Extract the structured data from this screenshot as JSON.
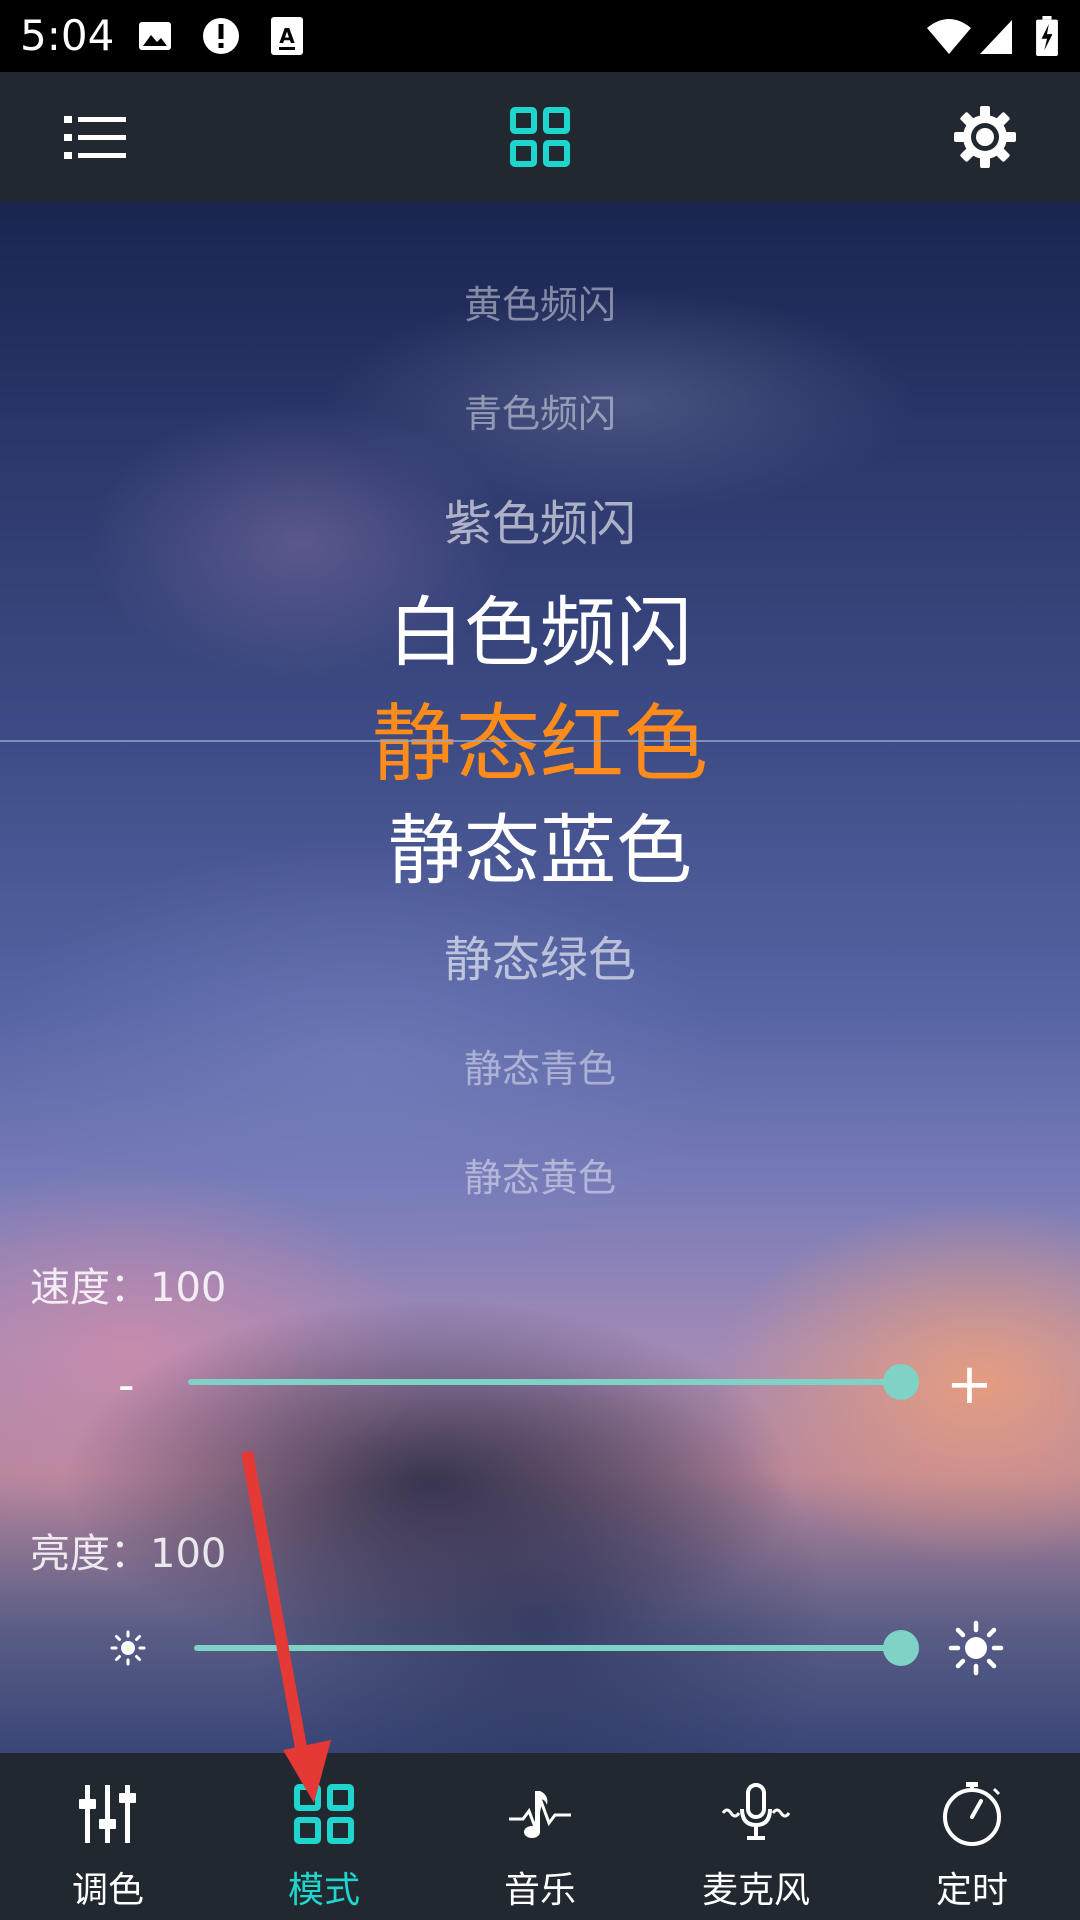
{
  "status_bar": {
    "time": "5:04",
    "icons": [
      "image-icon",
      "alert-icon",
      "text-icon",
      "wifi-icon",
      "signal-icon",
      "battery-charging-icon"
    ]
  },
  "app_bar": {
    "left_icon": "list-menu-icon",
    "center_icon": "grid-mode-icon",
    "right_icon": "gear-icon"
  },
  "picker": {
    "items": [
      "黄色频闪",
      "青色频闪",
      "紫色频闪",
      "白色频闪",
      "静态红色",
      "静态蓝色",
      "静态绿色",
      "静态青色",
      "静态黄色"
    ],
    "selected": "静态红色",
    "selected_color": "#ff8c1a"
  },
  "speed": {
    "label": "速度：100",
    "value": 100,
    "min": 0,
    "max": 100,
    "decrease_label": "-",
    "increase_label": "+"
  },
  "brightness": {
    "label": "亮度：100",
    "value": 100,
    "min": 0,
    "max": 100,
    "low_icon": "sun-small-icon",
    "high_icon": "sun-large-icon"
  },
  "bottom_nav": {
    "active_color": "#1fd6cf",
    "items": [
      {
        "label": "调色",
        "icon": "sliders-icon"
      },
      {
        "label": "模式",
        "icon": "grid-mode-icon",
        "active": true
      },
      {
        "label": "音乐",
        "icon": "music-note-icon"
      },
      {
        "label": "麦克风",
        "icon": "microphone-icon"
      },
      {
        "label": "定时",
        "icon": "timer-icon"
      }
    ]
  },
  "annotation": {
    "arrow_color": "#e53935"
  }
}
